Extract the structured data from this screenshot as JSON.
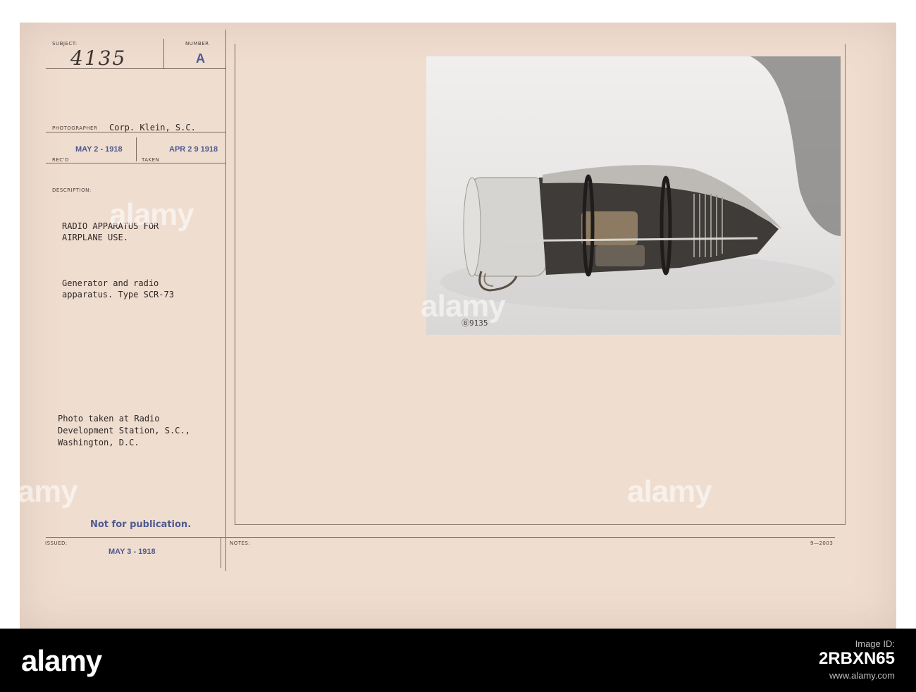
{
  "card": {
    "subject_label": "SUBJECT:",
    "subject_value": "4135",
    "number_label": "NUMBER",
    "number_value": "A",
    "photographer_label": "PHOTOGRAPHER",
    "photographer_value": "Corp. Klein, S.C.",
    "recd_label": "REC'D",
    "recd_value": "MAY 2 - 1918",
    "taken_label": "TAKEN",
    "taken_value": "APR 2 9 1918",
    "description_label": "DESCRIPTION:",
    "description_title": "RADIO APPARATUS FOR\nAIRPLANE USE.",
    "description_body": "Generator and radio\napparatus. Type SCR-73",
    "location_text": "Photo taken at Radio\nDevelopment Station, S.C.,\nWashington, D.C.",
    "not_for_publication": "Not for publication.",
    "issued_label": "ISSUED:",
    "issued_value": "MAY 3 - 1918",
    "notes_label": "NOTES:",
    "form_number": "9—2003",
    "photo_caption": "Ⓑ9135"
  },
  "watermark_text": "alamy",
  "footer": {
    "brand": "alamy",
    "image_id_label": "Image ID:",
    "image_id": "2RBXN65",
    "url": "www.alamy.com"
  }
}
